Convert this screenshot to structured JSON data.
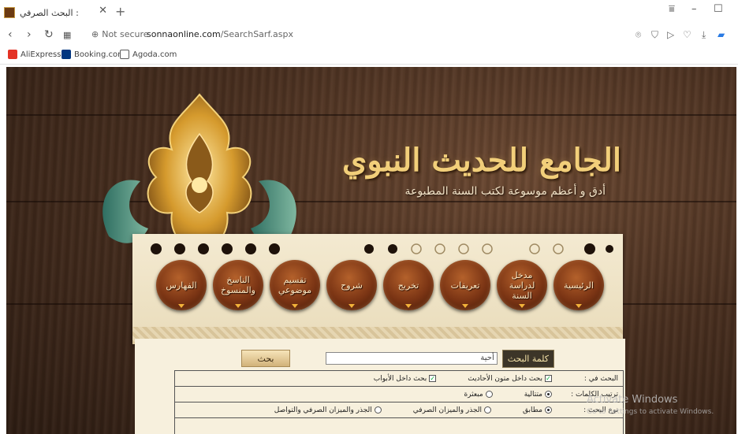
{
  "browser": {
    "tab_title": "البحث الصرفي :",
    "new_tab": "+",
    "security": "Not secure",
    "url_host": "sonnaonline.com",
    "url_path": "/SearchSarf.aspx",
    "bookmarks": [
      {
        "label": "AliExpress",
        "color": "#e43225"
      },
      {
        "label": "Booking.com",
        "color": "#003580"
      },
      {
        "label": "Agoda.com",
        "color": "#5c5c5c"
      }
    ]
  },
  "header": {
    "title": "الجامع للحديث النبوي",
    "subtitle": "أدق و أعظم موسوعة لكتب السنة المطبوعة"
  },
  "menu": {
    "items": [
      {
        "label": "الرئيسية"
      },
      {
        "label": "مدخل لدراسة السنة"
      },
      {
        "label": "تعريفات"
      },
      {
        "label": "تخريج"
      },
      {
        "label": "شروح"
      },
      {
        "label": "تقسيم موضوعي"
      },
      {
        "label": "الناسخ والمنسوخ"
      },
      {
        "label": "الفهارس"
      }
    ]
  },
  "search": {
    "label": "كلمة البحث",
    "value": "أحية",
    "button": "بحث"
  },
  "options": {
    "search_in_label": "البحث في :",
    "search_in_items": [
      "بحث داخل متون الأحاديث",
      "بحث داخل الأبواب"
    ],
    "order_label": "ترتيب الكلمات :",
    "order_items": [
      "متتالية",
      "مبعثرة"
    ],
    "type_label": "نوع البحث :",
    "type_items": [
      "مطابق",
      "الجذر والميزان الصرفي",
      "الجذر والميزان الصرفي والتواصل"
    ]
  },
  "watermark": {
    "title": "Activate Windows",
    "text": "Go to Settings to activate Windows."
  }
}
